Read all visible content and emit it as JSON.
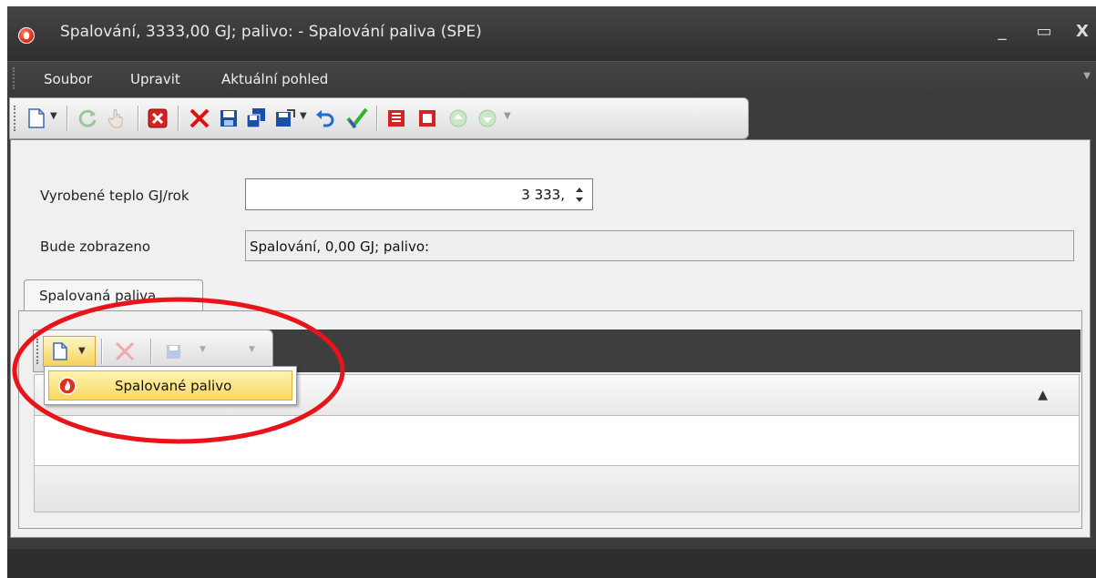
{
  "window": {
    "title": "Spalování,  3333,00 GJ; palivo:  - Spalování paliva (SPE)",
    "minimize_glyph": "_",
    "maximize_glyph": "▭",
    "close_glyph": "X"
  },
  "menu": {
    "items": [
      {
        "label": "Soubor"
      },
      {
        "label": "Upravit"
      },
      {
        "label": "Aktuální pohled"
      }
    ]
  },
  "toolbar": {
    "icons": [
      "new-document-icon",
      "dropdown-arrow-icon",
      "refresh-icon",
      "hand-icon",
      "cancel-icon",
      "delete-icon",
      "save-icon",
      "save-all-icon",
      "save-as-icon",
      "dropdown-arrow-icon",
      "undo-icon",
      "check-icon",
      "report-icon",
      "print-icon",
      "up-icon",
      "down-icon",
      "more-icon"
    ]
  },
  "form": {
    "heat_label": "Vyrobené teplo GJ/rok",
    "heat_value": "3 333,",
    "display_label": "Bude zobrazeno",
    "display_value": "Spalování,  0,00 GJ; palivo:"
  },
  "tabs": [
    {
      "label": "Spalovaná paliva"
    }
  ],
  "grid": {
    "sort_glyph": "▲"
  },
  "dropdown": {
    "items": [
      {
        "label": "Spalované palivo"
      }
    ]
  },
  "colors": {
    "annotation_circle": "#e8131b",
    "highlight": "#f8d860"
  }
}
